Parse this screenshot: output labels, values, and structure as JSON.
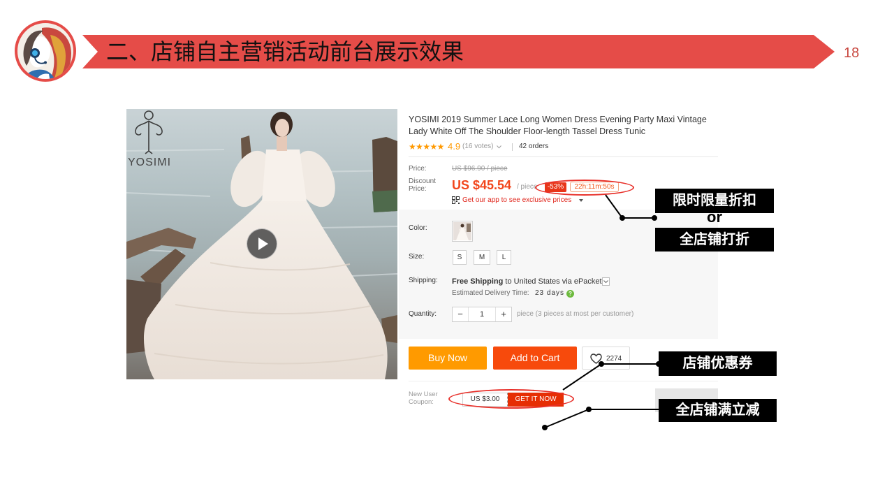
{
  "slide": {
    "title": "二、店铺自主营销活动前台展示效果",
    "page_number": "18"
  },
  "colors": {
    "banner": "#e54c48",
    "page_number": "#c8473f",
    "price": "#f2461c",
    "badge": "#e8361a",
    "buy_now": "#ff9a00",
    "add_to_cart": "#f74a0c",
    "annotation_ellipse": "#e8302a",
    "annotation_label": "#000000",
    "rating": "#ff9900",
    "delivery_help": "#6dba3e",
    "app_promo": "#e0251b"
  },
  "icons": [
    "customer-service-logo",
    "play-icon",
    "chevron-down-icon",
    "qr-code-icon",
    "caret-down-icon",
    "help-icon",
    "heart-icon"
  ],
  "product": {
    "photo": {
      "brand_logo_text": "YOSIMI"
    },
    "title": "YOSIMI 2019 Summer Lace Long Women Dress Evening Party Maxi Vintage Lady White Off The Shoulder Floor-length Tassel Dress Tunic",
    "rating": {
      "stars": "★★★★★",
      "score": "4.9",
      "votes": "(16 votes)"
    },
    "orders": "42 orders",
    "price": {
      "label": "Price:",
      "original": "US $96.90 / piece",
      "discount_label": "Discount Price:",
      "discount": "US $45.54",
      "unit": "/ piece",
      "badge": "-53%",
      "countdown": "22h:11m:50s",
      "app_promo": "Get our app to see exclusive prices"
    },
    "options": {
      "color_label": "Color:",
      "size_label": "Size:",
      "sizes": [
        "S",
        "M",
        "L"
      ],
      "shipping_label": "Shipping:",
      "shipping_method_bold": "Free Shipping",
      "shipping_method_rest": " to United States via ePacket",
      "delivery_label": "Estimated Delivery Time:",
      "delivery_days": "23 days",
      "delivery_help": "?",
      "quantity_label": "Quantity:",
      "quantity_minus": "−",
      "quantity_value": "1",
      "quantity_plus": "+",
      "quantity_note": "piece (3 pieces at most per customer)"
    },
    "actions": {
      "buy_now": "Buy Now",
      "add_to_cart": "Add to Cart",
      "wishlist_count": "2274"
    },
    "coupon": {
      "label": "New User Coupon:",
      "value": "US $3.00",
      "button": "GET IT NOW"
    }
  },
  "annotations": {
    "limited_time_discount": "限时限量折扣",
    "or": "or",
    "store_wide_discount": "全店铺打折",
    "store_coupon": "店铺优惠券",
    "store_full_reduction": "全店铺满立减"
  }
}
